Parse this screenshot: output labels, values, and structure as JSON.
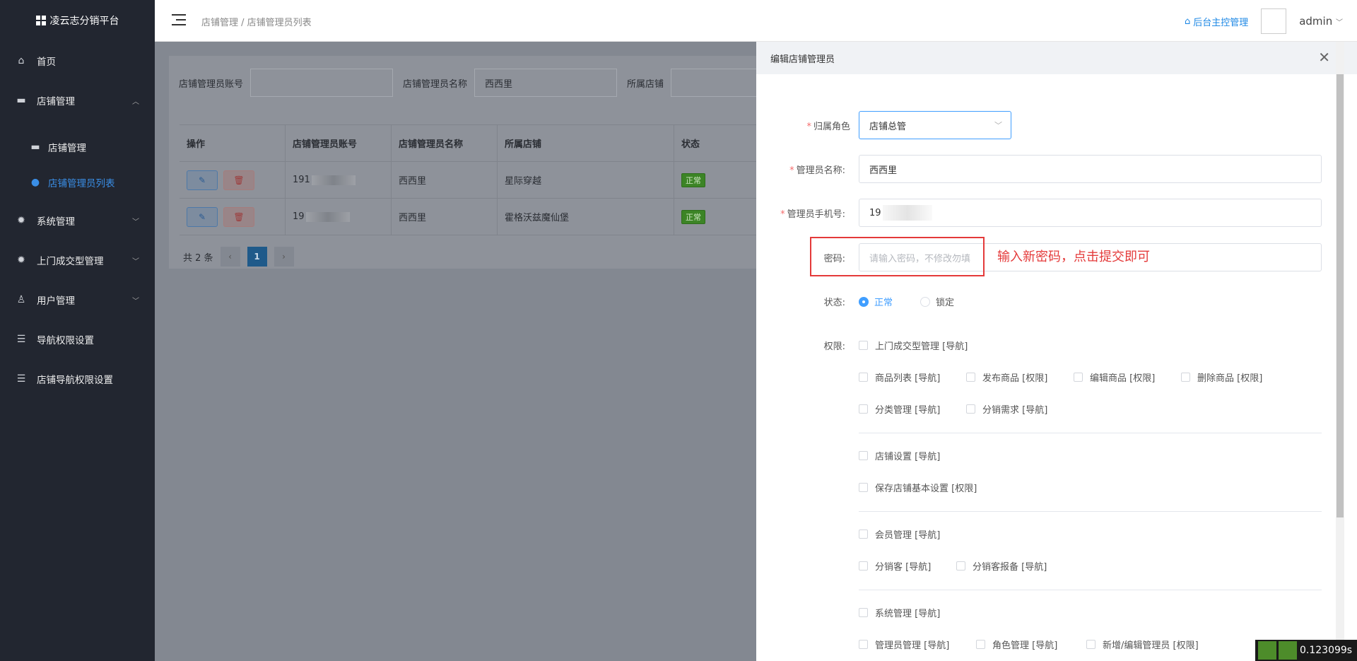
{
  "app": {
    "title": "凌云志分销平台"
  },
  "sidebar": {
    "items": [
      {
        "label": "首页",
        "icon": "home-icon"
      },
      {
        "label": "店铺管理",
        "icon": "store-icon"
      },
      {
        "label": "店铺管理",
        "icon": "store-icon"
      },
      {
        "label": "店铺管理员列表",
        "icon": "user-icon"
      },
      {
        "label": "系统管理",
        "icon": "gear-icon"
      },
      {
        "label": "上门成交型管理",
        "icon": "gear-icon"
      },
      {
        "label": "用户管理",
        "icon": "user-icon"
      },
      {
        "label": "导航权限设置",
        "icon": "sliders-icon"
      },
      {
        "label": "店铺导航权限设置",
        "icon": "sliders-icon"
      }
    ]
  },
  "header": {
    "breadcrumb": "店铺管理 / 店铺管理员列表",
    "home_link": "后台主控管理",
    "username": "admin"
  },
  "filter": {
    "account_label": "店铺管理员账号",
    "account_value": "",
    "name_label": "店铺管理员名称",
    "name_value": "西西里",
    "store_label": "所属店铺"
  },
  "table": {
    "headers": [
      "操作",
      "店铺管理员账号",
      "店铺管理员名称",
      "所属店铺",
      "状态"
    ],
    "rows": [
      {
        "account": "191",
        "name": "西西里",
        "store": "星际穿越",
        "status": "正常"
      },
      {
        "account": "19",
        "name": "西西里",
        "store": "霍格沃兹魔仙堡",
        "status": "正常"
      }
    ]
  },
  "pager": {
    "total": "共 2 条",
    "current": "1"
  },
  "drawer": {
    "title": "编辑店铺管理员",
    "role_label": "归属角色",
    "role_value": "店铺总管",
    "name_label": "管理员名称:",
    "name_value": "西西里",
    "phone_label": "管理员手机号:",
    "phone_value": "19",
    "password_label": "密码:",
    "password_placeholder": "请输入密码，不修改勿填",
    "annotation": "输入新密码，点击提交即可",
    "status_label": "状态:",
    "status_normal": "正常",
    "status_locked": "锁定",
    "perm_label": "权限:",
    "perms": [
      "上门成交型管理 [导航]",
      "商品列表 [导航]",
      "发布商品 [权限]",
      "编辑商品 [权限]",
      "删除商品 [权限]",
      "分类管理 [导航]",
      "分销需求 [导航]",
      "店铺设置 [导航]",
      "保存店铺基本设置 [权限]",
      "会员管理 [导航]",
      "分销客 [导航]",
      "分销客报备 [导航]",
      "系统管理 [导航]",
      "管理员管理 [导航]",
      "角色管理 [导航]",
      "新增/编辑管理员 [权限]"
    ]
  },
  "timer": "0.123099s",
  "colors": {
    "accent": "#409eff",
    "sidebar": "#222630",
    "annotation": "#e43a3a"
  }
}
